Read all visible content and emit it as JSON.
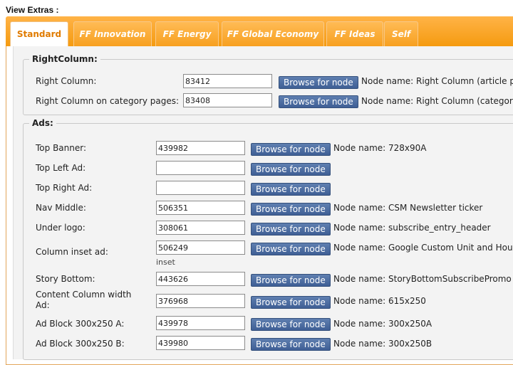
{
  "page": {
    "title": "View Extras :"
  },
  "tabs": [
    {
      "label": "Standard"
    },
    {
      "label": "FF Innovation"
    },
    {
      "label": "FF Energy"
    },
    {
      "label": "FF Global Economy"
    },
    {
      "label": "FF Ideas"
    },
    {
      "label": "Self"
    }
  ],
  "right_column": {
    "legend": "RightColumn:",
    "browse_label": "Browse for node",
    "rows": [
      {
        "label": "Right Column:",
        "value": "83412",
        "node_name": "Node name: Right Column (article pa"
      },
      {
        "label": "Right Column on category pages:",
        "value": "83408",
        "node_name": "Node name: Right Column (category"
      }
    ]
  },
  "ads": {
    "legend": "Ads:",
    "browse_label": "Browse for node",
    "rows": [
      {
        "label": "Top Banner:",
        "value": "439982",
        "node_name": "Node name: 728x90A"
      },
      {
        "label": "Top Left Ad:",
        "value": "",
        "node_name": ""
      },
      {
        "label": "Top Right Ad:",
        "value": "",
        "node_name": ""
      },
      {
        "label": "Nav Middle:",
        "value": "506351",
        "node_name": "Node name: CSM Newsletter ticker"
      },
      {
        "label": "Under logo:",
        "value": "308061",
        "node_name": "Node name: subscribe_entry_header"
      },
      {
        "label": "Column inset ad:",
        "value": "506249",
        "node_name": "Node name: Google Custom Unit and House",
        "sub": "inset"
      },
      {
        "label": "Story Bottom:",
        "value": "443626",
        "node_name": "Node name: StoryBottomSubscribePromo"
      },
      {
        "label": "Content Column width Ad:",
        "value": "376968",
        "node_name": "Node name: 615x250"
      },
      {
        "label": "Ad Block 300x250 A:",
        "value": "439978",
        "node_name": "Node name: 300x250A"
      },
      {
        "label": "Ad Block 300x250 B:",
        "value": "439980",
        "node_name": "Node name: 300x250B"
      }
    ]
  }
}
